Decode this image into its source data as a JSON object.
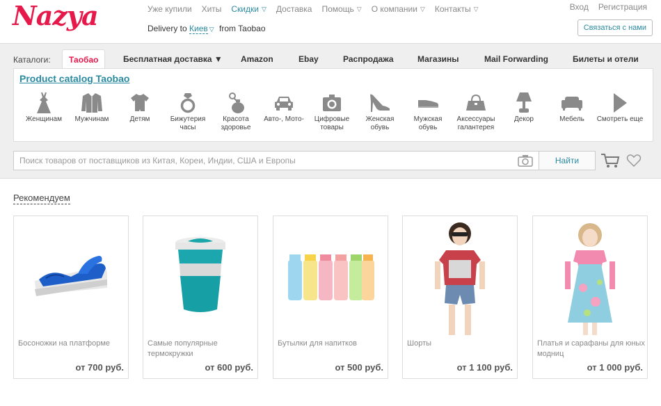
{
  "header": {
    "logo": "Nazya",
    "topnav": [
      {
        "label": "Уже купили",
        "caret": false,
        "teal": false
      },
      {
        "label": "Хиты",
        "caret": false,
        "teal": false
      },
      {
        "label": "Скидки",
        "caret": true,
        "teal": true
      },
      {
        "label": "Доставка",
        "caret": false,
        "teal": false
      },
      {
        "label": "Помощь",
        "caret": true,
        "teal": false
      },
      {
        "label": "О компании",
        "caret": true,
        "teal": false
      },
      {
        "label": "Контакты",
        "caret": true,
        "teal": false
      }
    ],
    "delivery_prefix": "Delivery to",
    "delivery_city": "Киев",
    "delivery_suffix": "from Taobao",
    "login": "Вход",
    "register": "Регистрация",
    "contact_button": "Связаться с нами"
  },
  "catalogs": {
    "label": "Каталоги:",
    "tabs": [
      {
        "label": "Таобао",
        "active": true
      },
      {
        "label": "Бесплатная доставка ▼",
        "active": false
      },
      {
        "label": "Amazon",
        "active": false
      },
      {
        "label": "Ebay",
        "active": false
      },
      {
        "label": "Распродажа",
        "active": false
      },
      {
        "label": "Магазины",
        "active": false
      },
      {
        "label": "Mail Forwarding",
        "active": false
      },
      {
        "label": "Билеты и отели",
        "active": false
      }
    ],
    "catalog_title": "Product catalog Taobao",
    "categories": [
      {
        "label": "Женщинам",
        "icon": "dress-icon"
      },
      {
        "label": "Мужчинам",
        "icon": "jacket-icon"
      },
      {
        "label": "Детям",
        "icon": "baby-bodysuit-icon"
      },
      {
        "label": "Бижутерия часы",
        "icon": "ring-icon"
      },
      {
        "label": "Красота здоровье",
        "icon": "perfume-icon"
      },
      {
        "label": "Авто-, Мото-",
        "icon": "car-icon"
      },
      {
        "label": "Цифровые товары",
        "icon": "camera-icon"
      },
      {
        "label": "Женская обувь",
        "icon": "high-heel-icon"
      },
      {
        "label": "Мужская обувь",
        "icon": "mens-shoe-icon"
      },
      {
        "label": "Аксессуары галантерея",
        "icon": "handbag-icon"
      },
      {
        "label": "Декор",
        "icon": "lamp-icon"
      },
      {
        "label": "Мебель",
        "icon": "sofa-icon"
      },
      {
        "label": "Смотреть еще",
        "icon": "play-arrow-icon"
      }
    ]
  },
  "search": {
    "placeholder": "Поиск товаров от поставщиков из Китая, Кореи, Индии, США и Европы",
    "value": "",
    "button": "Найти"
  },
  "recommended": {
    "title": "Рекомендуем",
    "products": [
      {
        "name": "Босоножки на платформе",
        "price": "от 700 руб.",
        "image": "blue-platform-sandal"
      },
      {
        "name": "Самые популярные термокружки",
        "price": "от 600 руб.",
        "image": "teal-travel-mug"
      },
      {
        "name": "Бутылки для напитков",
        "price": "от 500 руб.",
        "image": "colored-bottles"
      },
      {
        "name": "Шорты",
        "price": "от 1 100 руб.",
        "image": "girl-in-denim-shorts"
      },
      {
        "name": "Платья и сарафаны для юных модниц",
        "price": "от 1 000 руб.",
        "image": "girl-in-floral-dress"
      }
    ]
  },
  "colors": {
    "brand": "#e6194b",
    "link": "#2a8aa0",
    "panel": "#efefef",
    "icon": "#8a8a8a"
  }
}
